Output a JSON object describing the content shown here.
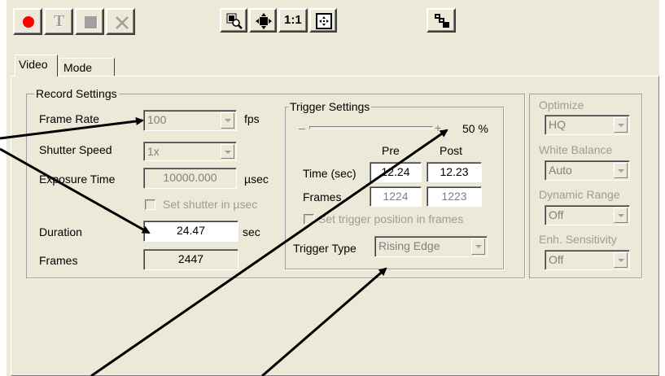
{
  "toolbar": {
    "record_label": "Record",
    "trigger_label": "T",
    "stop_label": "Stop",
    "cancel_label": "Cancel",
    "zoom_fit_label": "Zoom",
    "center_label": "Center",
    "one_to_one_label": "1:1",
    "fit_window_label": "Fit",
    "cascade_label": "Cascade"
  },
  "tabs": [
    {
      "label": "Video",
      "active": true
    },
    {
      "label": "Mode",
      "active": false
    }
  ],
  "record_settings": {
    "title": "Record Settings",
    "frame_rate_label": "Frame Rate",
    "frame_rate_value": "100",
    "frame_rate_unit": "fps",
    "shutter_speed_label": "Shutter Speed",
    "shutter_speed_value": "1x",
    "exposure_time_label": "Exposure Time",
    "exposure_time_value": "10000.000",
    "exposure_time_unit": "µsec",
    "set_shutter_label": "Set shutter in µsec",
    "duration_label": "Duration",
    "duration_value": "24.47",
    "duration_unit": "sec",
    "frames_label": "Frames",
    "frames_value": "2447"
  },
  "trigger_settings": {
    "title": "Trigger Settings",
    "slider_minus": "–",
    "slider_plus": "+",
    "slider_percent": "50 %",
    "pre_label": "Pre",
    "post_label": "Post",
    "time_label": "Time (sec)",
    "time_pre": "12.24",
    "time_post": "12.23",
    "frames_label": "Frames",
    "frames_pre": "1224",
    "frames_post": "1223",
    "set_position_label": "Set trigger position in frames",
    "trigger_type_label": "Trigger Type",
    "trigger_type_value": "Rising Edge"
  },
  "optimize": {
    "title": "Optimize",
    "optimize_value": "HQ",
    "white_balance_label": "White Balance",
    "white_balance_value": "Auto",
    "dynamic_range_label": "Dynamic Range",
    "dynamic_range_value": "Off",
    "enh_sensitivity_label": "Enh. Sensitivity",
    "enh_sensitivity_value": "Off"
  },
  "colors": {
    "window_bg": "#ece9d8",
    "record_dot": "#ff0000",
    "annotation_arrow": "#000000"
  }
}
